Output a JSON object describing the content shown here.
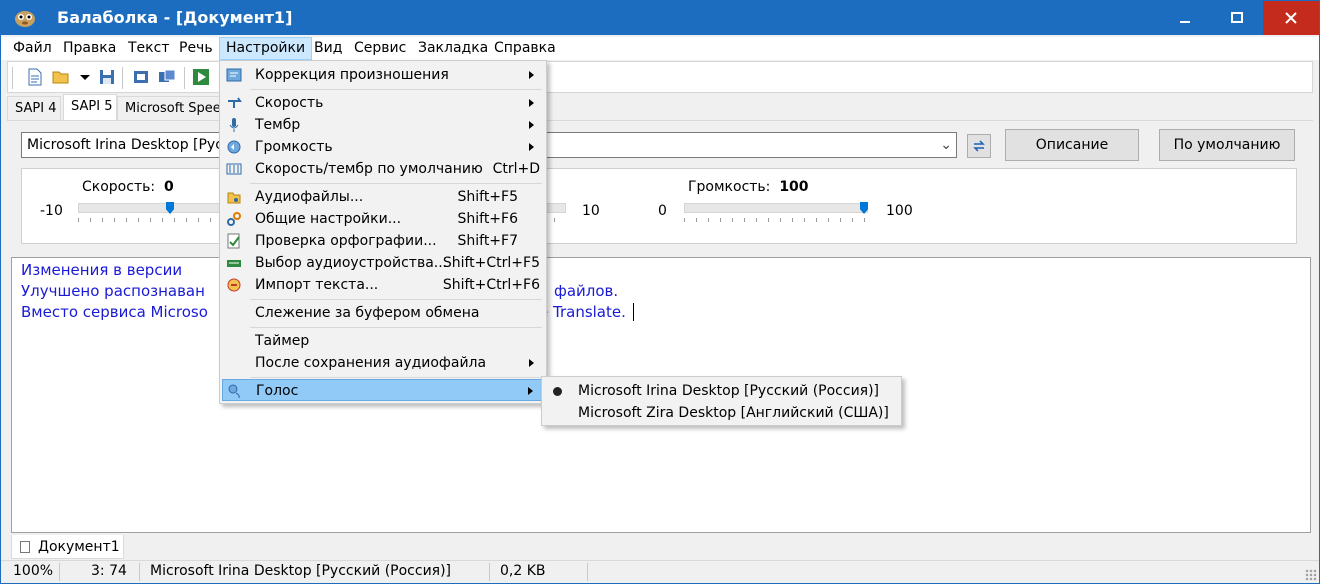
{
  "window": {
    "title": "Балаболка - [Документ1]"
  },
  "menubar": {
    "items": [
      "Файл",
      "Правка",
      "Текст",
      "Речь",
      "Настройки",
      "Вид",
      "Сервис",
      "Закладка",
      "Справка"
    ],
    "active": "Настройки"
  },
  "tabs": [
    "SAPI 4",
    "SAPI 5",
    "Microsoft Spee"
  ],
  "voice": {
    "selected": "Microsoft Irina Desktop [Русс",
    "describe_label": "Описание",
    "defaults_label": "По умолчанию"
  },
  "sliders": {
    "speed": {
      "label": "Скорость:",
      "value": "0",
      "min": "-10",
      "max": "10",
      "level": 0.5
    },
    "pitch": {
      "max": "10"
    },
    "volume": {
      "label": "Громкость:",
      "value": "100",
      "min": "0",
      "max": "100",
      "level": 1.0
    }
  },
  "editor": {
    "lines": [
      "Изменения в версии",
      "Улучшено распознаван",
      "Вместо сервиса Microso"
    ],
    "line_tails": [
      "файлов.",
      "e Translate."
    ]
  },
  "document_tab": "Документ1",
  "statusbar": {
    "zoom": "100%",
    "position": "3:  74",
    "voice": "Microsoft Irina Desktop [Русский (Россия)]",
    "size": "0,2 KB"
  },
  "settings_menu": {
    "items": [
      {
        "label": "Коррекция произношения",
        "submenu": true,
        "icon": "pronunciation-icon"
      },
      {
        "label": "Скорость",
        "submenu": true,
        "icon": "speed-icon"
      },
      {
        "label": "Тембр",
        "submenu": true,
        "icon": "microphone-icon"
      },
      {
        "label": "Громкость",
        "submenu": true,
        "icon": "volume-icon"
      },
      {
        "label": "Скорость/тембр по умолчанию",
        "shortcut": "Ctrl+D",
        "icon": "equalizer-icon"
      },
      {
        "label": "Аудиофайлы...",
        "shortcut": "Shift+F5",
        "icon": "audio-files-icon"
      },
      {
        "label": "Общие настройки...",
        "shortcut": "Shift+F6",
        "icon": "settings-icon"
      },
      {
        "label": "Проверка орфографии...",
        "shortcut": "Shift+F7",
        "icon": "spellcheck-icon"
      },
      {
        "label": "Выбор аудиоустройства...",
        "shortcut": "Shift+Ctrl+F5",
        "icon": "audio-device-icon"
      },
      {
        "label": "Импорт текста...",
        "shortcut": "Shift+Ctrl+F6",
        "icon": "import-text-icon"
      },
      {
        "label": "Слежение за буфером обмена"
      },
      {
        "label": "Таймер"
      },
      {
        "label": "После сохранения аудиофайла",
        "submenu": true
      },
      {
        "label": "Голос",
        "submenu": true,
        "highlighted": true,
        "icon": "voice-icon"
      }
    ]
  },
  "voice_submenu": {
    "items": [
      {
        "label": "Microsoft Irina Desktop [Русский (Россия)]",
        "selected": true
      },
      {
        "label": "Microsoft Zira Desktop [Английский (США)]",
        "selected": false
      }
    ]
  },
  "colors": {
    "titlebar": "#1c6dbf",
    "close_button": "#c42b1c",
    "editor_text": "#1a1ad6",
    "menu_highlight": "#91c9f7",
    "slider_thumb": "#0078d7"
  }
}
